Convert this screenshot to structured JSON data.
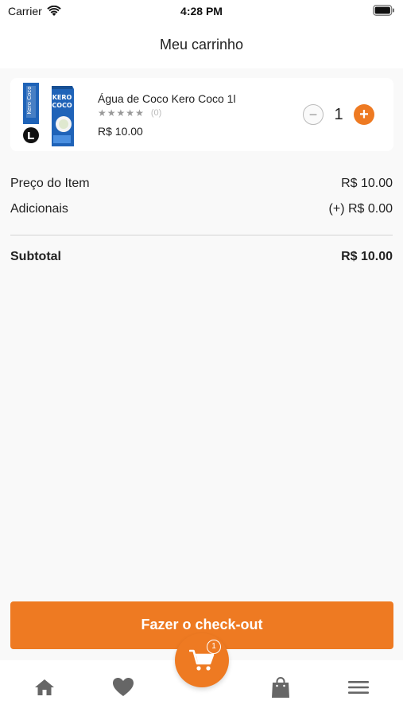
{
  "status_bar": {
    "carrier": "Carrier",
    "time": "4:28 PM",
    "wifi_icon": "wifi-icon",
    "battery_icon": "battery-icon"
  },
  "header": {
    "title": "Meu carrinho"
  },
  "cart": {
    "items": [
      {
        "name": "Água de Coco Kero Coco 1l",
        "rating": 0,
        "rating_count": "(0)",
        "price": "R$ 10.00",
        "quantity": "1",
        "decrement_icon": "minus-icon",
        "increment_icon": "plus-icon",
        "image_brand": "KERO COCO"
      }
    ]
  },
  "summary": {
    "item_price_label": "Preço do Item",
    "item_price_value": "R$ 10.00",
    "extras_label": "Adicionais",
    "extras_value": "(+) R$ 0.00",
    "subtotal_label": "Subtotal",
    "subtotal_value": "R$ 10.00"
  },
  "checkout": {
    "label": "Fazer o check-out"
  },
  "tab_bar": {
    "items": [
      "home-icon",
      "heart-icon",
      "cart-icon",
      "bag-icon",
      "menu-icon"
    ],
    "cart_badge": "1"
  },
  "colors": {
    "accent": "#ee7a22",
    "background": "#f9f9f9",
    "card": "#ffffff",
    "tab_icon": "#666666"
  }
}
